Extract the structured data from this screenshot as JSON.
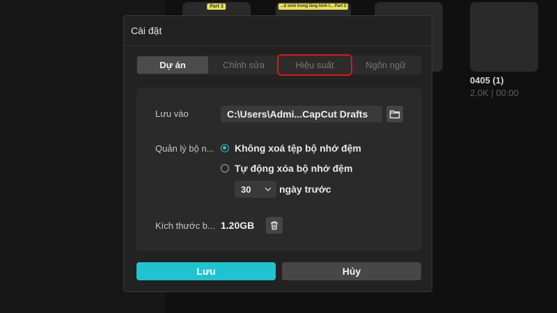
{
  "background": {
    "thumbnails": [
      {
        "caption": "Part 3"
      },
      {
        "caption": "...ệ sinh trong lăng kính t... Part 2"
      },
      {
        "caption": ""
      },
      {
        "caption": ""
      }
    ],
    "project": {
      "name": "0405 (1)",
      "meta": "2.0K | 00:00"
    }
  },
  "dialog": {
    "title": "Cài đặt",
    "tabs": [
      {
        "label": "Dự án",
        "active": true
      },
      {
        "label": "Chỉnh sửa",
        "active": false
      },
      {
        "label": "Hiệu suất",
        "active": false,
        "highlighted": true
      },
      {
        "label": "Ngôn ngữ",
        "active": false
      }
    ],
    "save_location": {
      "label": "Lưu vào",
      "path": "C:\\Users\\Admi...CapCut Drafts",
      "icon": "folder-icon"
    },
    "cache": {
      "label": "Quản lý bộ n...",
      "options": [
        {
          "label": "Không xoá tệp bộ nhớ đệm",
          "selected": true
        },
        {
          "label": "Tự động xóa bộ nhớ đệm",
          "selected": false
        }
      ],
      "days_value": "30",
      "days_suffix": "ngày trước"
    },
    "cache_size": {
      "label": "Kích thước b...",
      "value": "1.20GB",
      "icon": "trash-icon"
    },
    "buttons": {
      "save": "Lưu",
      "cancel": "Hủy"
    }
  },
  "colors": {
    "accent": "#20c4d1",
    "highlight": "#e01616",
    "dialog_bg": "#222222",
    "panel_bg": "#2a2a2a"
  }
}
